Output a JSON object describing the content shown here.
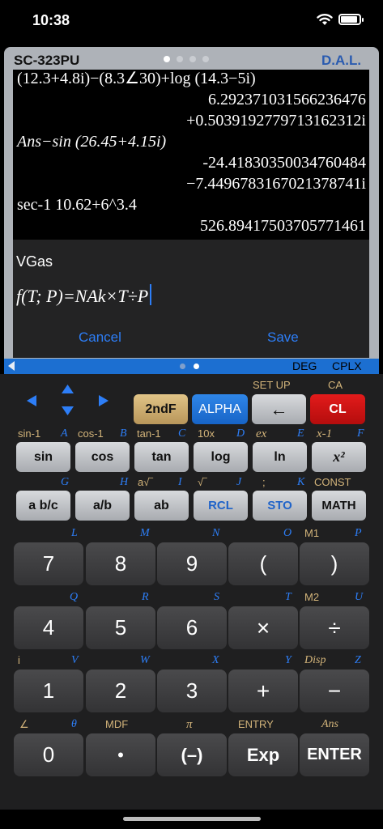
{
  "status": {
    "time": "10:38"
  },
  "header": {
    "brand": "SC-323PU",
    "maker": "D.A.L."
  },
  "display": {
    "lines": [
      {
        "text": "(12.3+4.8i)−(8.3∠30)+log (14.3−5i)",
        "align": "l"
      },
      {
        "text": "6.292371031566236476",
        "align": "r"
      },
      {
        "text": "+0.5039192779713162312i",
        "align": "r"
      },
      {
        "text": "Ans−sin (26.45+4.15i)",
        "align": "l"
      },
      {
        "text": "-24.41830350034760484",
        "align": "r"
      },
      {
        "text": "−7.4496783167021378741i",
        "align": "r"
      },
      {
        "text": "sec-1 10.62+6^3.4",
        "align": "l"
      },
      {
        "text": "526.89417503705771461",
        "align": "r"
      }
    ]
  },
  "editor": {
    "name": "VGas",
    "formula": "f(T; P)=NAk×T÷P",
    "cancel": "Cancel",
    "save": "Save"
  },
  "modebar": {
    "deg": "DEG",
    "cplx": "CPLX"
  },
  "keys": {
    "row1": {
      "second": "2ndF",
      "alpha": "ALPHA",
      "back": "←",
      "clear": "CL",
      "labels": {
        "setup": "SET UP",
        "ca": "CA"
      }
    },
    "row2": [
      "sin",
      "cos",
      "tan",
      "log",
      "ln",
      "x²"
    ],
    "row2_labels": {
      "sin": "sin-1",
      "a": "A",
      "cos": "cos-1",
      "b": "B",
      "tan": "tan-1",
      "c": "C",
      "ten": "10x",
      "d": "D",
      "e": "ex",
      "e2": "E",
      "inv": "x-1",
      "f": "F"
    },
    "row3": [
      "a b/c",
      "a/b",
      "ab",
      "RCL",
      "STO",
      "MATH"
    ],
    "row3_labels": {
      "g": "G",
      "h": "H",
      "a2": "a√‾",
      "i": "I",
      "sq": "√‾",
      "j": "J",
      "semi": ";",
      "k": "K",
      "const": "CONST"
    },
    "row4": [
      "7",
      "8",
      "9",
      "(",
      ")"
    ],
    "row4_labels": {
      "l": "L",
      "m": "M",
      "n": "N",
      "o": "O",
      "m1": "M1",
      "p": "P"
    },
    "row5": [
      "4",
      "5",
      "6",
      "×",
      "÷"
    ],
    "row5_labels": {
      "q": "Q",
      "r": "R",
      "s": "S",
      "t": "T",
      "m2": "M2",
      "u": "U"
    },
    "row6": [
      "1",
      "2",
      "3",
      "+",
      "−"
    ],
    "row6_labels": {
      "i": "i",
      "v": "V",
      "w": "W",
      "x": "X",
      "y": "Y",
      "disp": "Disp",
      "z": "Z"
    },
    "row7": [
      "0",
      "•",
      "(–)",
      "Exp",
      "ENTER"
    ],
    "row7_labels": {
      "angle": "∠",
      "theta": "θ",
      "mdf": "MDF",
      "pi": "π",
      "entry": "ENTRY",
      "ans": "Ans"
    }
  }
}
